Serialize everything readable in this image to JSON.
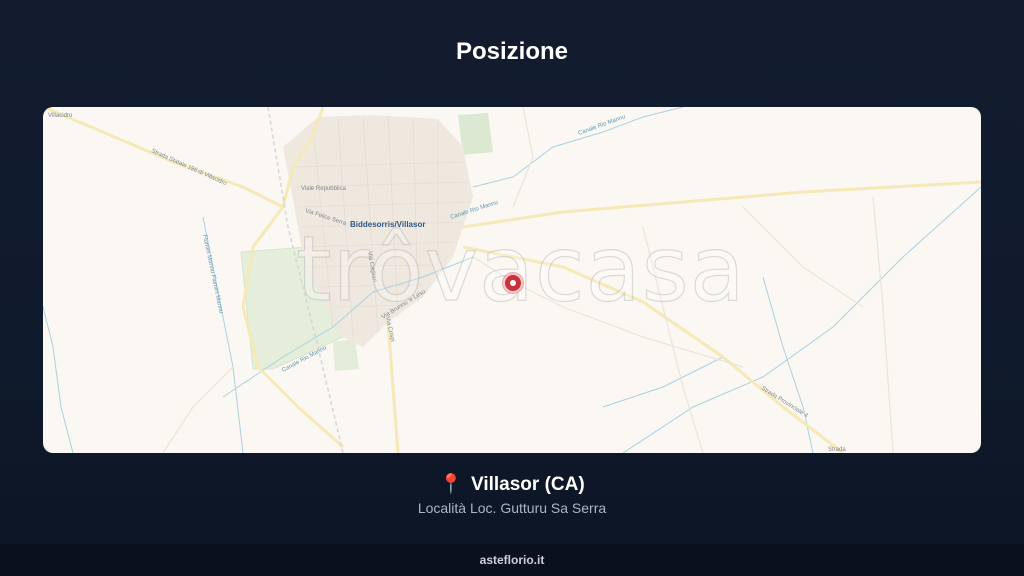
{
  "page": {
    "title": "Posizione"
  },
  "map": {
    "watermark": "trôvacasa",
    "labels": {
      "town": "Biddesorris/Villasor",
      "viale_repubblica": "Viale Repubblica",
      "via_felice_serra": "Via Felice Serra",
      "strada_statale": "Strada Statale 196 di Villacidro",
      "villacidro": "Villacidro",
      "via_brunu": "Via Brunnu 'e Lesu",
      "via_cagliari": "Via Cagliari",
      "via_crispi": "Via Crispi",
      "canale_rio_mannu_top": "Canale Rio Mannu",
      "canale_rio_mannu_mid": "Canale Rio Mannu",
      "canale_rio_mannu_bottom": "Canale Rio Mannu",
      "fiume_mannu": "Flumini Mannu  Fiumini Mannu",
      "strada_provinciale": "Strada Provinciale 4",
      "bottom_right": "Strada"
    }
  },
  "location": {
    "pin_icon": "📍",
    "city": "Villasor (CA)",
    "address": "Località Loc. Gutturu Sa Serra"
  },
  "footer": {
    "brand": "asteflorio.it"
  }
}
